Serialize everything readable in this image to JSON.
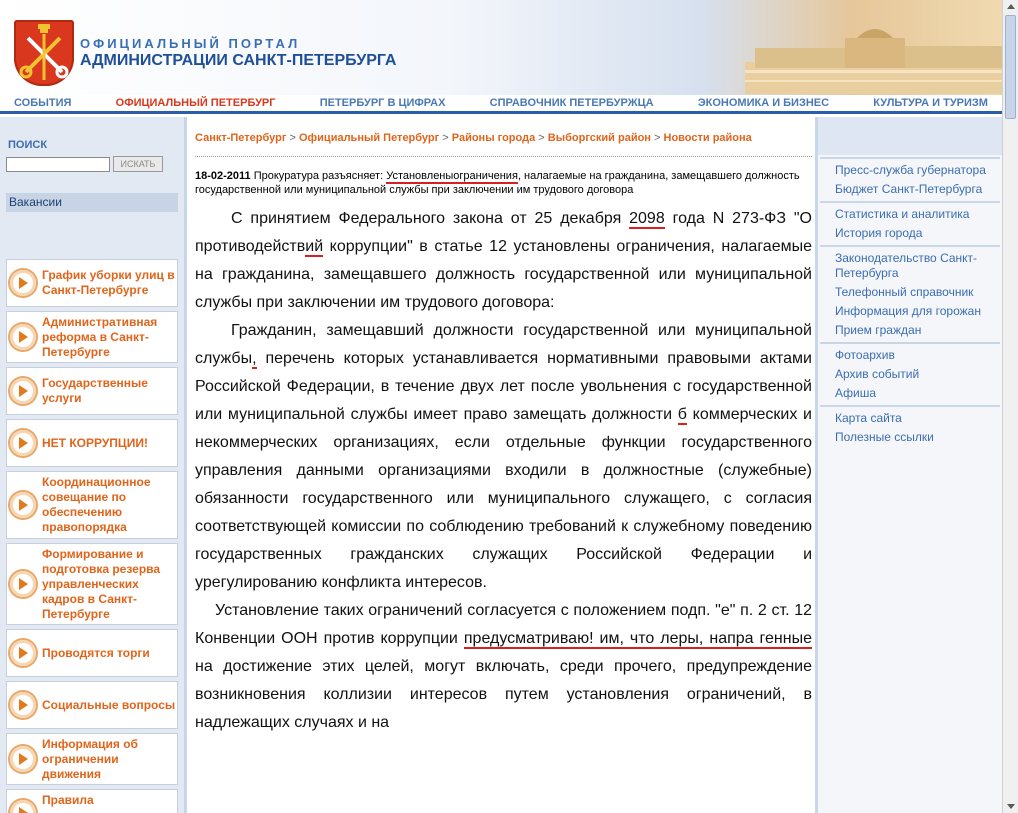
{
  "header": {
    "portal_line1": "ОФИЦИАЛЬНЫЙ ПОРТАЛ",
    "portal_line2": "АДМИНИСТРАЦИИ САНКТ-ПЕТЕРБУРГА"
  },
  "nav": [
    "СОБЫТИЯ",
    "ОФИЦИАЛЬНЫЙ ПЕТЕРБУРГ",
    "ПЕТЕРБУРГ В ЦИФРАХ",
    "СПРАВОЧНИК ПЕТЕРБУРЖЦА",
    "ЭКОНОМИКА И БИЗНЕС",
    "КУЛЬТУРА И ТУРИЗМ"
  ],
  "search": {
    "title": "ПОИСК",
    "value": "",
    "button": "ИСКАТЬ"
  },
  "sidebar_left": {
    "vacancies": "Вакансии",
    "buttons": [
      "График уборки улиц в Санкт-Петербурге",
      "Административная реформа в Санкт-Петербурге",
      "Государственные услуги",
      "НЕТ КОРРУПЦИИ!",
      "Координационное совещание по обеспечению правопорядка",
      "Формирование и подготовка резерва управленческих кадров в Санкт-Петербурге",
      "Проводятся торги",
      "Социальные вопросы",
      "Информация об ограничении движения",
      "Правила"
    ]
  },
  "breadcrumb": [
    "Санкт-Петербург",
    "Официальный Петербург",
    "Районы города",
    "Выборгский район",
    "Новости района"
  ],
  "breadcrumb_sep": ">",
  "news": {
    "date": "18-02-2011",
    "lead": "Прокуратура разъясняет:",
    "underlined": "Установленыограничения",
    "rest": ", налагаемые на гражданина, замещавшего должность государственной или муниципальной службы при заключении им трудового договора"
  },
  "article": {
    "p1_a": "С принятием Федерального закона от 25 декабря ",
    "p1_mark1": "2098",
    "p1_b": " года N 273-ФЗ \"О противодейств",
    "p1_mark2": "ий",
    "p1_c": " коррупции\" в статье 12 установлены ограничения, налагаемые на гражданина, замещавшего должность государственной или муниципальной службы при заключении им трудового договора:",
    "p2_a": "Гражданин, замещавший должности государственной или муниципальной службы",
    "p2_mark1": ",",
    "p2_b": " перечень которых устанавливается нормативными правовыми актами Российской Федерации, в течение двух лет после увольнения с государственной или муниципальной службы имеет право замещать должности ",
    "p2_mark2": "б",
    "p2_c": " коммерческих и некоммерческих организациях, если отдельные функции государственного управления данными организациями входили в должностные (служебные) обязанности государственного или муниципального служащего, с согласия соответствующей комиссии по соблюдению требований к служебному поведению государственных гражданских служащих Российской Федерации и урегулированию конфликта интересов.",
    "p3_a": "Установление таких ограничений согласуется с положением подп. \"е\" п. 2 ст. 12 Конвенции ООН против коррупции ",
    "p3_mark1": "предусматриваю! им, что леры, напра генные",
    "p3_b": " на достижение этих целей, могут включать, среди прочего, предупреждение возникновения коллизии интересов путем установления ограничений, в надлежащих случаях и на"
  },
  "sidebar_right": {
    "groups": [
      [
        "Пресс-служба губернатора",
        "Бюджет Санкт-Петербурга"
      ],
      [
        "Статистика и аналитика",
        "История города"
      ],
      [
        "Законодательство Санкт-Петербурга",
        "Телефонный справочник",
        "Информация для горожан",
        "Прием граждан"
      ],
      [
        "Фотоархив",
        "Архив событий",
        "Афиша"
      ],
      [
        "Карта сайта",
        "Полезные ссылки"
      ]
    ]
  },
  "colors": {
    "accent_orange": "#e0651b",
    "brand_blue": "#2b5ea8",
    "correction_red": "#d92020"
  }
}
